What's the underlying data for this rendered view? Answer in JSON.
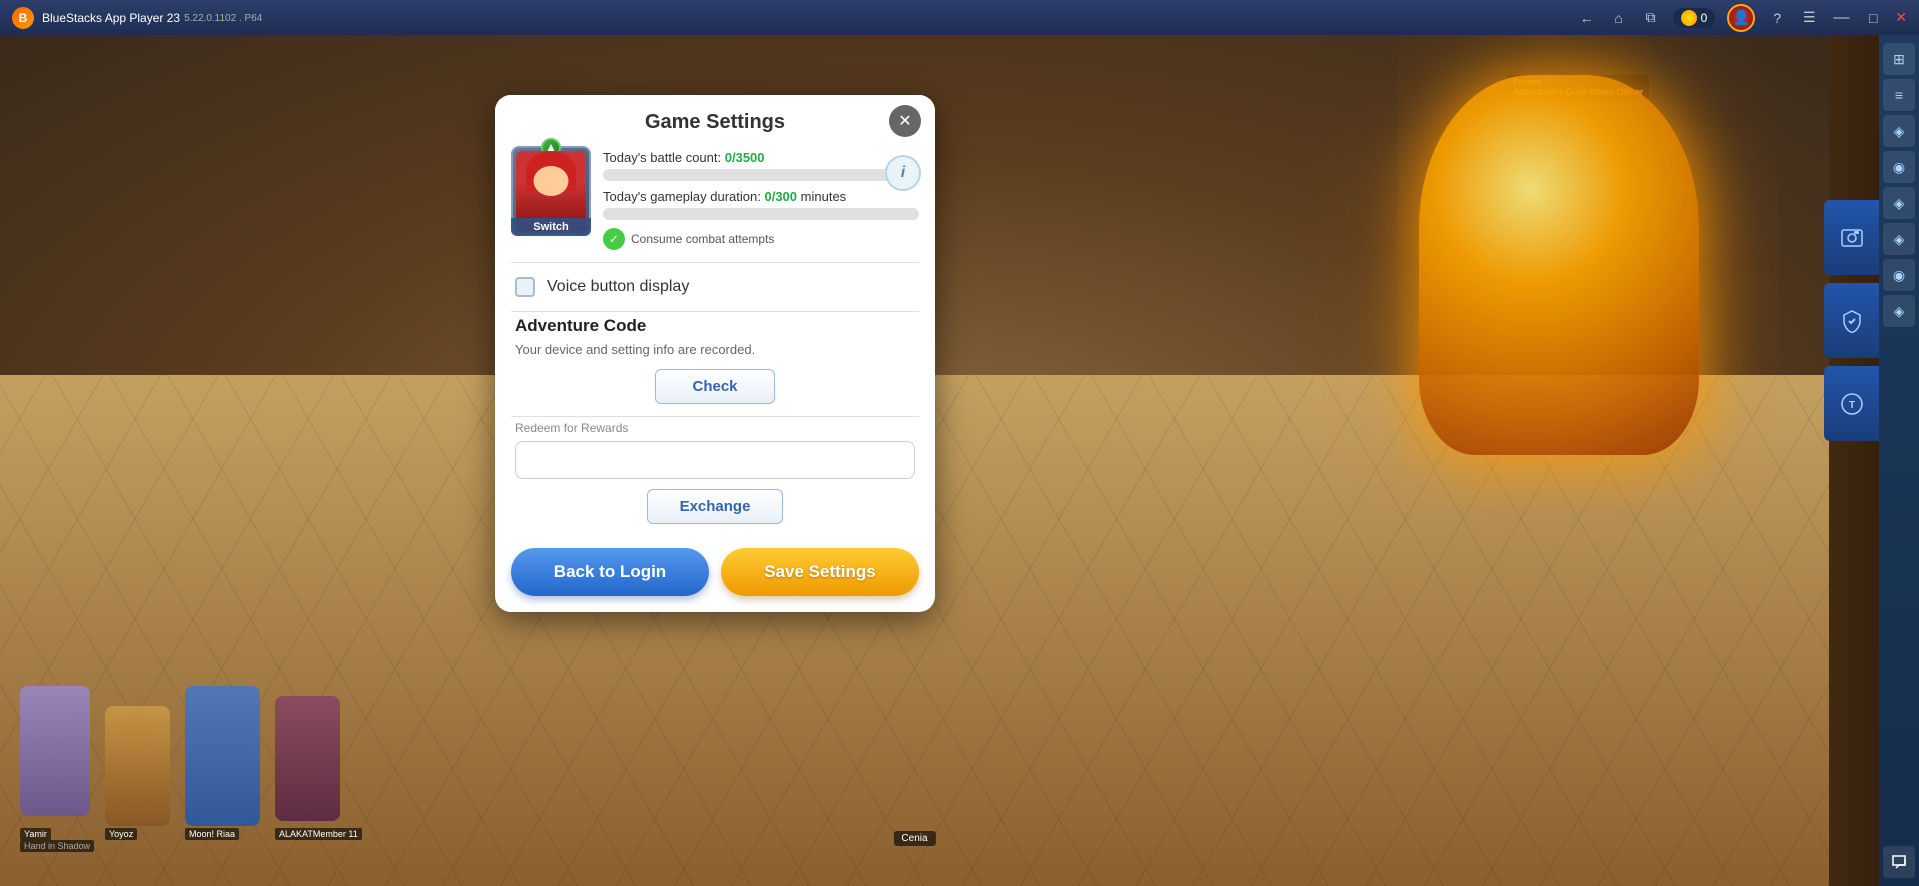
{
  "app": {
    "title": "BlueStacks App Player 23",
    "subtitle": "5.22.0.1102 . P64",
    "coin_count": "0"
  },
  "titlebar": {
    "back_icon": "←",
    "home_icon": "⌂",
    "copy_icon": "⧉",
    "coin_label": "0",
    "avatar_icon": "👤",
    "help_icon": "?",
    "menu_icon": "☰",
    "minimize_icon": "—",
    "maximize_icon": "□",
    "close_icon": "✕"
  },
  "sidebar": {
    "icons": [
      "⊞",
      "≡",
      "⬡",
      "⬡",
      "⬡",
      "⬡",
      "⬡",
      "⬡",
      "⬡"
    ]
  },
  "right_panels": {
    "panel1_icon": "🖼",
    "panel2_icon": "🛡",
    "chat_icon": "💬"
  },
  "dialog": {
    "title": "Game Settings",
    "close_icon": "✕",
    "info_icon": "i",
    "avatar_label": "Switch",
    "today_battle_label": "Today's battle count:",
    "today_battle_value": "0/3500",
    "today_gameplay_label": "Today's gameplay duration:",
    "today_gameplay_value": "0/300",
    "today_gameplay_suffix": "minutes",
    "consume_combat_text": "Consume combat attempts",
    "voice_button_label": "Voice button display",
    "adventure_code_title": "Adventure Code",
    "adventure_code_desc": "Your device and setting info are recorded.",
    "check_button": "Check",
    "redeem_label": "Redeem for Rewards",
    "redeem_placeholder": "",
    "exchange_button": "Exchange",
    "back_to_login": "Back to Login",
    "save_settings": "Save Settings"
  },
  "npc": {
    "name": "Purnell",
    "title": "Adventurer's Guild Affairs Officer"
  },
  "players": {
    "player1_name": "Yamir",
    "player1_title": "Hand in Shadow",
    "player2_name": "Yoyoz",
    "player3_name": "Moon! Riaa",
    "player4_name": "ALAKATMember 11"
  },
  "npc2": {
    "name": "Cenia"
  }
}
